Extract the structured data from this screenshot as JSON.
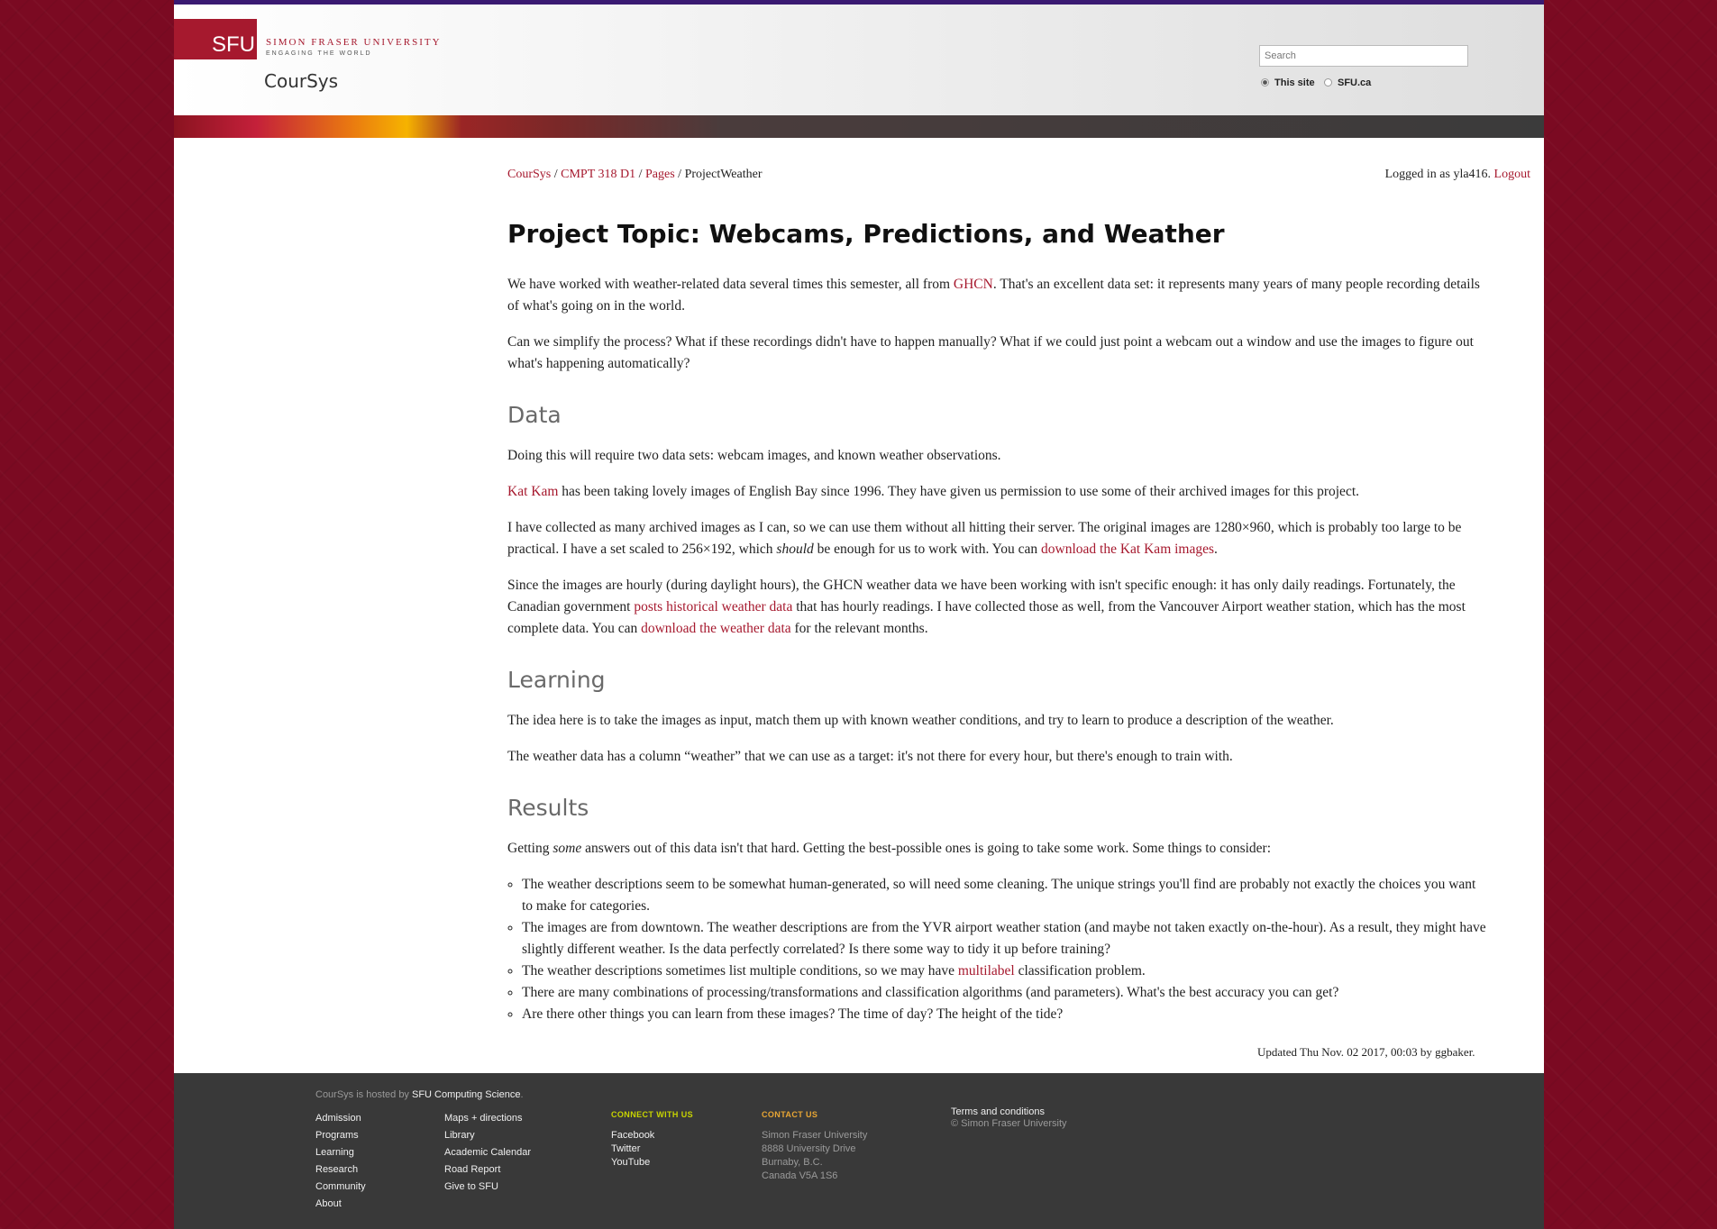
{
  "header": {
    "logo_text": "SFU",
    "university_name": "SIMON FRASER UNIVERSITY",
    "tagline": "ENGAGING THE WORLD",
    "site_name": "CourSys",
    "search_placeholder": "Search",
    "radio_this_site": "This site",
    "radio_sfu": "SFU.ca"
  },
  "breadcrumb": {
    "items": [
      "CourSys",
      "CMPT 318 D1",
      "Pages"
    ],
    "sep": "/",
    "current": "ProjectWeather"
  },
  "login": {
    "text": "Logged in as yla416.",
    "logout": "Logout"
  },
  "content": {
    "title": "Project Topic: Webcams, Predictions, and Weather",
    "p1_a": "We have worked with weather-related data several times this semester, all from ",
    "p1_link": "GHCN",
    "p1_b": ". That's an excellent data set: it represents many years of many people recording details of what's going on in the world.",
    "p2": "Can we simplify the process? What if these recordings didn't have to happen manually? What if we could just point a webcam out a window and use the images to figure out what's happening automatically?",
    "h_data": "Data",
    "p3": "Doing this will require two data sets: webcam images, and known weather observations.",
    "p4_link": "Kat Kam",
    "p4_b": " has been taking lovely images of English Bay since 1996. They have given us permission to use some of their archived images for this project.",
    "p5_a": "I have collected as many archived images as I can, so we can use them without all hitting their server. The original images are 1280×960, which is probably too large to be practical. I have a set scaled to 256×192, which ",
    "p5_em": "should",
    "p5_b": " be enough for us to work with. You can ",
    "p5_link": "download the Kat Kam images",
    "p5_c": ".",
    "p6_a": "Since the images are hourly (during daylight hours), the GHCN weather data we have been working with isn't specific enough: it has only daily readings. Fortunately, the Canadian government ",
    "p6_link1": "posts historical weather data",
    "p6_b": " that has hourly readings. I have collected those as well, from the Vancouver Airport weather station, which has the most complete data. You can ",
    "p6_link2": "download the weather data",
    "p6_c": " for the relevant months.",
    "h_learning": "Learning",
    "p7": "The idea here is to take the images as input, match them up with known weather conditions, and try to learn to produce a description of the weather.",
    "p8": "The weather data has a column “weather” that we can use as a target: it's not there for every hour, but there's enough to train with.",
    "h_results": "Results",
    "p9_a": "Getting ",
    "p9_em": "some",
    "p9_b": " answers out of this data isn't that hard. Getting the best-possible ones is going to take some work. Some things to consider:",
    "li1": "The weather descriptions seem to be somewhat human-generated, so will need some cleaning. The unique strings you'll find are probably not exactly the choices you want to make for categories.",
    "li2": "The images are from downtown. The weather descriptions are from the YVR airport weather station (and maybe not taken exactly on-the-hour). As a result, they might have slightly different weather. Is the data perfectly correlated? Is there some way to tidy it up before training?",
    "li3_a": "The weather descriptions sometimes list multiple conditions, so we may have ",
    "li3_link": "multilabel",
    "li3_b": " classification problem.",
    "li4": "There are many combinations of processing/transformations and classification algorithms (and parameters). What's the best accuracy you can get?",
    "li5": "Are there other things you can learn from these images? The time of day? The height of the tide?"
  },
  "updated": "Updated Thu Nov. 02 2017, 00:03 by ggbaker.",
  "footer": {
    "hosted_a": "CourSys is hosted by ",
    "hosted_link": "SFU Computing Science",
    "hosted_b": ".",
    "col1": [
      "Admission",
      "Programs",
      "Learning",
      "Research",
      "Community",
      "About"
    ],
    "col2": [
      "Maps + directions",
      "Library",
      "Academic Calendar",
      "Road Report",
      "Give to SFU"
    ],
    "connect_heading": "CONNECT WITH US",
    "connect": [
      "Facebook",
      "Twitter",
      "YouTube"
    ],
    "contact_heading": "CONTACT US",
    "contact": [
      "Simon Fraser University",
      "8888 University Drive",
      "Burnaby, B.C.",
      "Canada V5A 1S6"
    ],
    "terms": "Terms and conditions",
    "copyright": "© Simon Fraser University"
  },
  "colors": {
    "brand_red": "#a6192e",
    "connect_heading": "#c8d400",
    "contact_heading": "#e8a634"
  }
}
